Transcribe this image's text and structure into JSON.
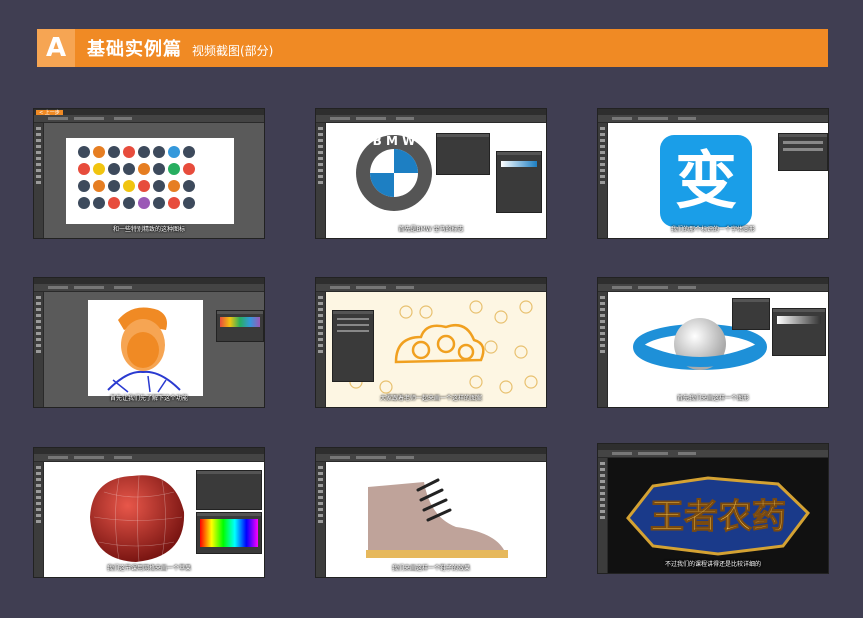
{
  "header": {
    "badge": "A",
    "title": "基础实例篇",
    "subtitle": "视频截图(部分)"
  },
  "colors": {
    "background": "#403e52",
    "banner": "#f08a24",
    "badge": "#f6a553"
  },
  "thumbnails": [
    {
      "caption": "和一些特别精致的这种图标",
      "subject": "flat circular icons grid",
      "tag": "< 上一步"
    },
    {
      "caption": "首先是BMW 宝马的标志",
      "subject": "BMW logo",
      "logo_text": "B M W"
    },
    {
      "caption": "我们的那个标识的一个字体变形",
      "subject": "Chinese character logo",
      "logo_text": "变"
    },
    {
      "caption": "首先让我们先了解下这个功能",
      "subject": "Trump portrait illustration"
    },
    {
      "caption": "大家跟着老师一起来画一个这样的图案",
      "subject": "golden cloud swirl pattern"
    },
    {
      "caption": "首先我们来画这样一个图形",
      "subject": "3D sphere and ring"
    },
    {
      "caption": "我们这节课用网格来画一个苹果",
      "subject": "red apple gradient mesh"
    },
    {
      "caption": "我们来画这样一个鞋子的效果",
      "subject": "shoe illustration"
    },
    {
      "caption": "不过我们的课程讲得还是比较详细的",
      "subject": "game logo text effect",
      "logo_text": "王者农药"
    }
  ]
}
